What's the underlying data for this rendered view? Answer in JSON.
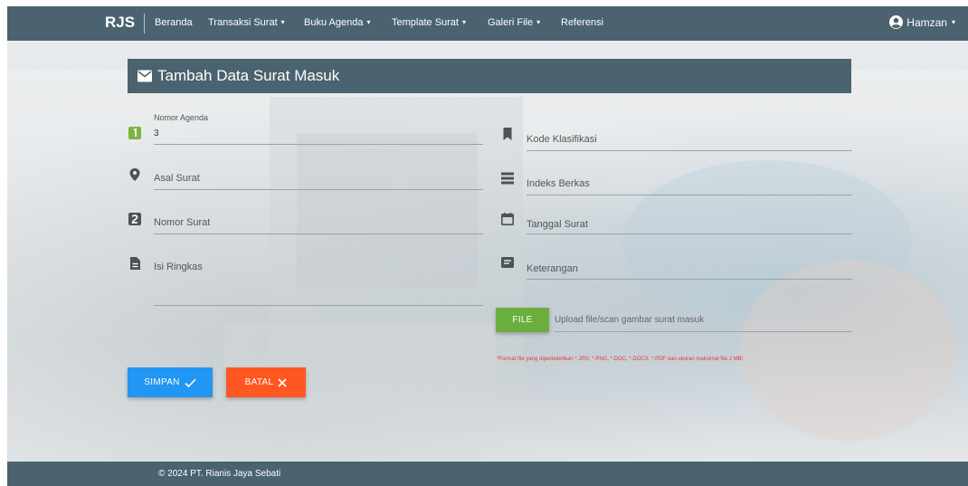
{
  "brand": "RJS",
  "nav": {
    "items": [
      {
        "label": "Beranda",
        "dropdown": false
      },
      {
        "label": "Transaksi Surat",
        "dropdown": true
      },
      {
        "label": "Buku Agenda",
        "dropdown": true
      },
      {
        "label": "Template Surat",
        "dropdown": true
      },
      {
        "label": "Galeri File",
        "dropdown": true
      },
      {
        "label": "Referensi",
        "dropdown": false
      }
    ],
    "user": "Hamzan",
    "caret": "▾"
  },
  "form": {
    "title": "Tambah Data Surat Masuk",
    "nomor_agenda": {
      "label": "Nomor Agenda",
      "value": "3"
    },
    "kode_klasifikasi": {
      "label": "Kode Klasifikasi"
    },
    "asal_surat": {
      "label": "Asal Surat"
    },
    "indeks_berkas": {
      "label": "Indeks Berkas"
    },
    "nomor_surat": {
      "label": "Nomor Surat"
    },
    "tanggal_surat": {
      "label": "Tanggal Surat"
    },
    "isi_ringkas": {
      "label": "Isi Ringkas"
    },
    "keterangan": {
      "label": "Keterangan"
    },
    "file": {
      "button": "FILE",
      "placeholder": "Upload file/scan gambar surat masuk",
      "note": "*Format file yang diperbolehkan *.JPG, *.PNG, *.DOC, *.DOCX, *.PDF dan ukuran maksimal file 2 MB!"
    },
    "save_button": "SIMPAN",
    "cancel_button": "BATAL"
  },
  "footer": "© 2024 PT. Rianis Jaya Sebati",
  "colors": {
    "navbar": "#4b626f",
    "save": "#2196f3",
    "cancel": "#ff5722",
    "file": "#6aaf3d",
    "note": "#e53935",
    "icon_agenda": "#7cb342",
    "icon_dark": "#4b5358"
  }
}
